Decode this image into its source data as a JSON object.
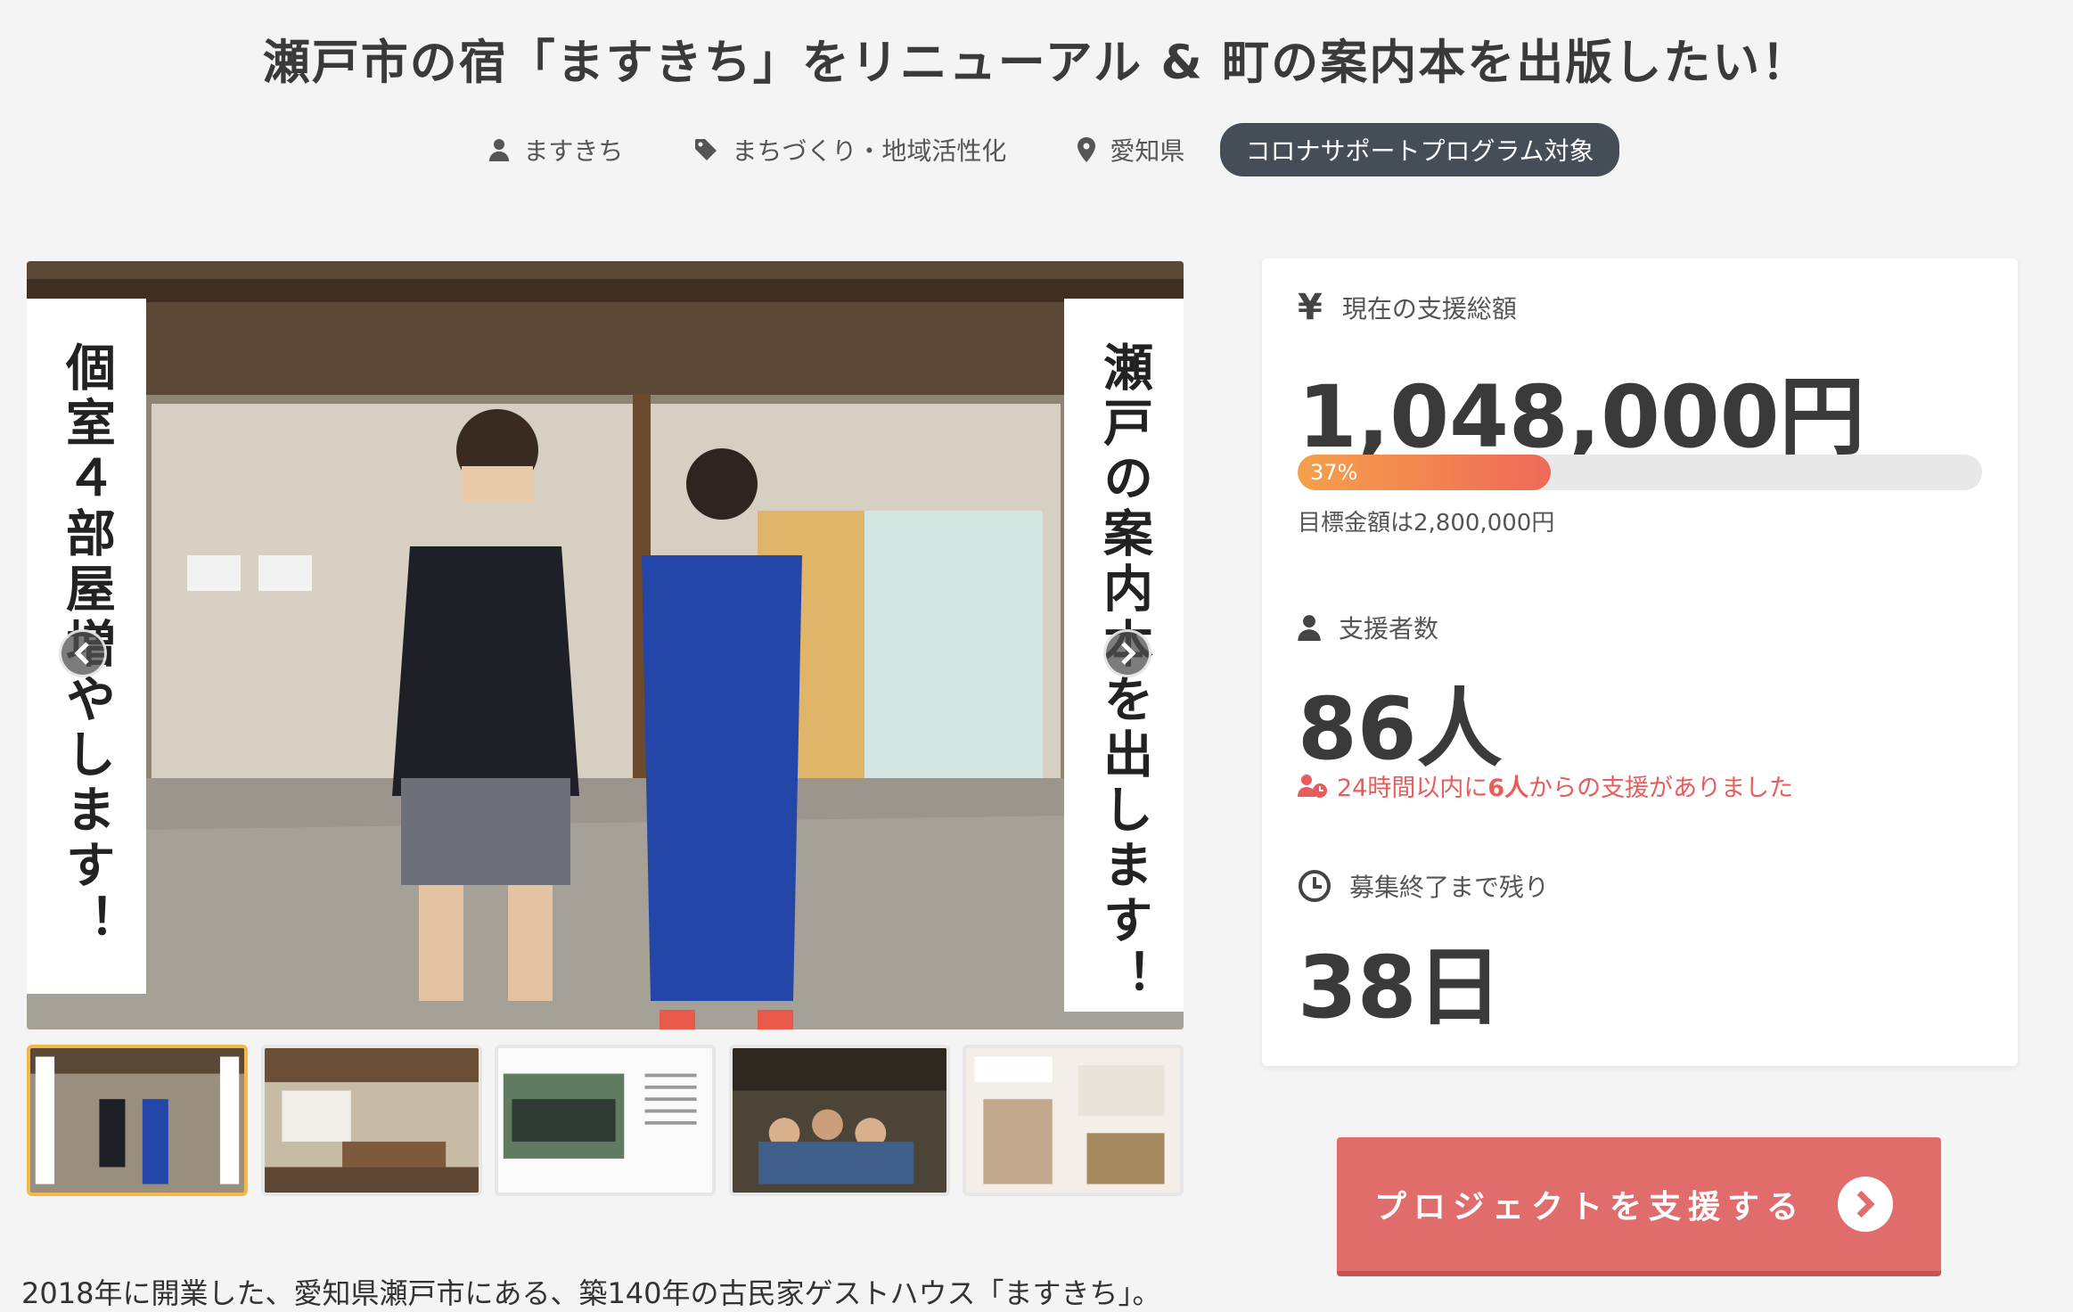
{
  "project": {
    "title": "瀬戸市の宿「ますきち」をリニューアル & 町の案内本を出版したい！",
    "owner": "ますきち",
    "category": "まちづくり・地域活性化",
    "location": "愛知県",
    "badge": "コロナサポートプログラム対象"
  },
  "hero": {
    "left_caption": "個室４部屋増やします！",
    "right_caption": "瀬戸の案内本を出します！"
  },
  "stats": {
    "total_label": "現在の支援総額",
    "total_amount": "1,048,000円",
    "progress_percent_label": "37%",
    "progress_percent": 37,
    "goal_text": "目標金額は2,800,000円",
    "backers_label": "支援者数",
    "backers_count": "86人",
    "recent_prefix": "24時間以内に",
    "recent_count": "6人",
    "recent_suffix": "からの支援がありました",
    "remaining_label": "募集終了まで残り",
    "remaining_days": "38日"
  },
  "cta": {
    "label": "プロジェクトを支援する"
  },
  "intro": {
    "text": "2018年に開業した、愛知県瀬戸市にある、築140年の古民家ゲストハウス「ますきち」。"
  },
  "colors": {
    "accent": "#e06c6c",
    "badge_bg": "#454d57",
    "progress_start": "#f5a04a",
    "progress_end": "#ee6a58",
    "thumb_active": "#f2b94a"
  }
}
